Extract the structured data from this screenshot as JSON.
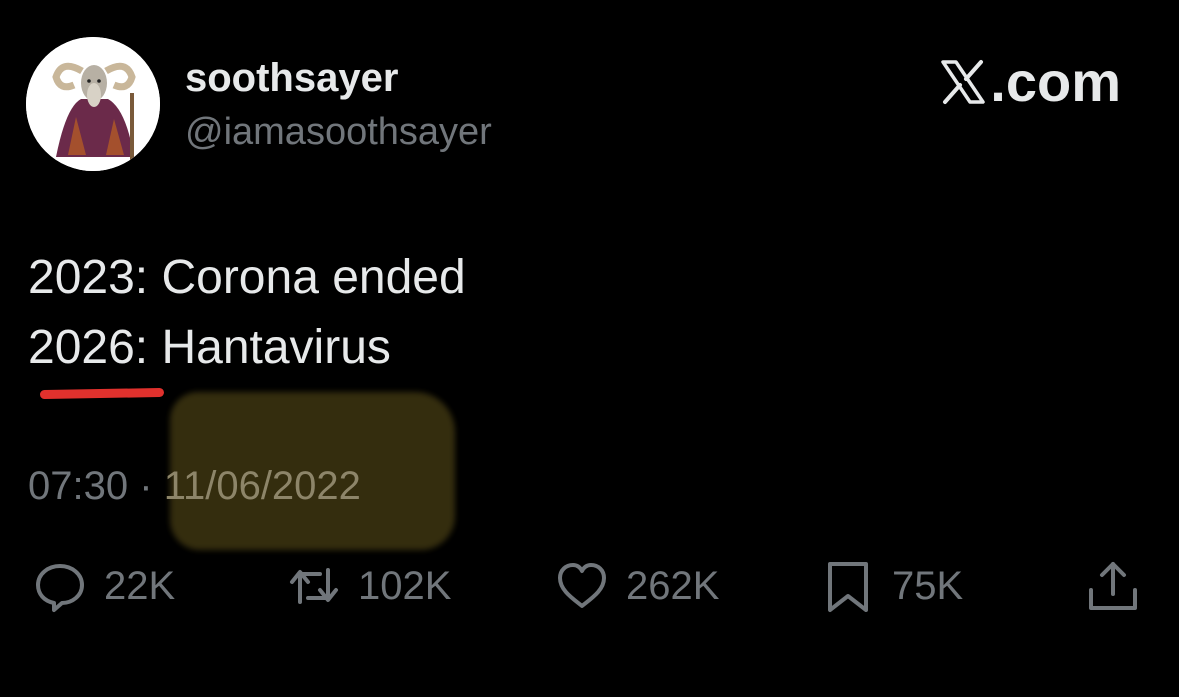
{
  "author": {
    "display_name": "soothsayer",
    "handle": "@iamasoothsayer",
    "avatar_icon": "goat-soothsayer-avatar"
  },
  "brand": {
    "label": ".com",
    "icon": "x-logo-icon"
  },
  "tweet": {
    "line1": "2023: Corona ended",
    "line2": "2026: Hantavirus"
  },
  "meta": {
    "time": "07:30",
    "separator": "·",
    "date": "11/06/2022"
  },
  "actions": {
    "replies": "22K",
    "retweets": "102K",
    "likes": "262K",
    "bookmarks": "75K"
  },
  "colors": {
    "background": "#000000",
    "text_primary": "#e7e9ea",
    "text_secondary": "#71767b",
    "annotation_underline": "#e0312d",
    "annotation_highlight": "#3a3210"
  }
}
